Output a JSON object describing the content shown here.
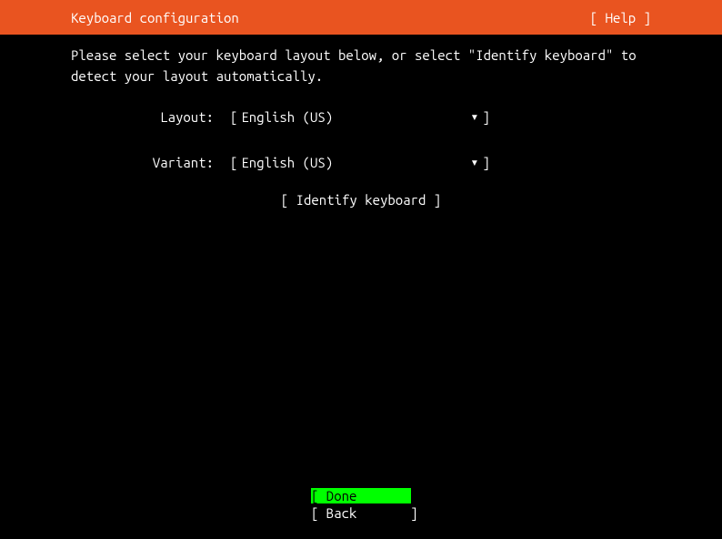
{
  "header": {
    "title": "Keyboard configuration",
    "help_label": "[ Help ]"
  },
  "instruction": "Please select your keyboard layout below, or select \"Identify keyboard\" to detect your layout automatically.",
  "form": {
    "layout": {
      "label": "Layout:",
      "value": "English (US)"
    },
    "variant": {
      "label": "Variant:",
      "value": "English (US)"
    }
  },
  "identify_label": "[ Identify keyboard ]",
  "footer": {
    "done_label": "[ Done       ]",
    "back_label": "[ Back       ]"
  },
  "glyphs": {
    "bracket_open": "[",
    "bracket_close": "]",
    "caret_down": "▾"
  }
}
